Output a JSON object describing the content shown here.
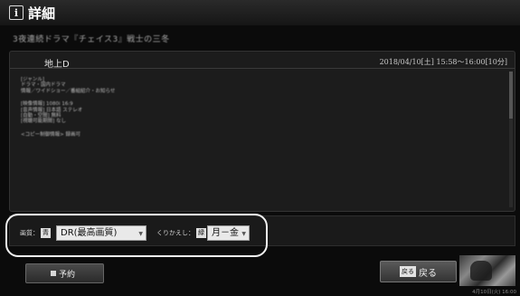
{
  "header": {
    "title": "詳細",
    "icon_glyph": "i"
  },
  "program": {
    "title": "3夜連続ドラマ『チェイス3』戦士の三冬"
  },
  "panel": {
    "channel": "地上D",
    "datetime": "2018/04/10[土] 15:58～16:00[10分]",
    "details": [
      [
        "[ジャンル]",
        "ドラマ・国内ドラマ",
        "情報／ワイドショー／番組紹介・お知らせ"
      ],
      [
        "[映像情報] 1080i 16:9",
        "[音声情報] 日本語 ステレオ",
        "[自動・空間] 無料",
        "[視聴可能期間] なし"
      ],
      [
        "<コピー制御情報> 録画可"
      ]
    ]
  },
  "settings": {
    "quality_label": "画質：",
    "quality_tag": "青",
    "quality_value": "DR(最高画質)",
    "repeat_label": "くりかえし：",
    "repeat_tag": "緑",
    "repeat_value": "月－金"
  },
  "buttons": {
    "reserve_label": "予約",
    "back_tag": "戻る",
    "back_label": "戻る"
  },
  "footer": {
    "time": "4月10日(火) 16:00"
  },
  "icons": {
    "info": "info-icon",
    "square": "square-icon",
    "dropdown": "dropdown-arrow-icon"
  }
}
